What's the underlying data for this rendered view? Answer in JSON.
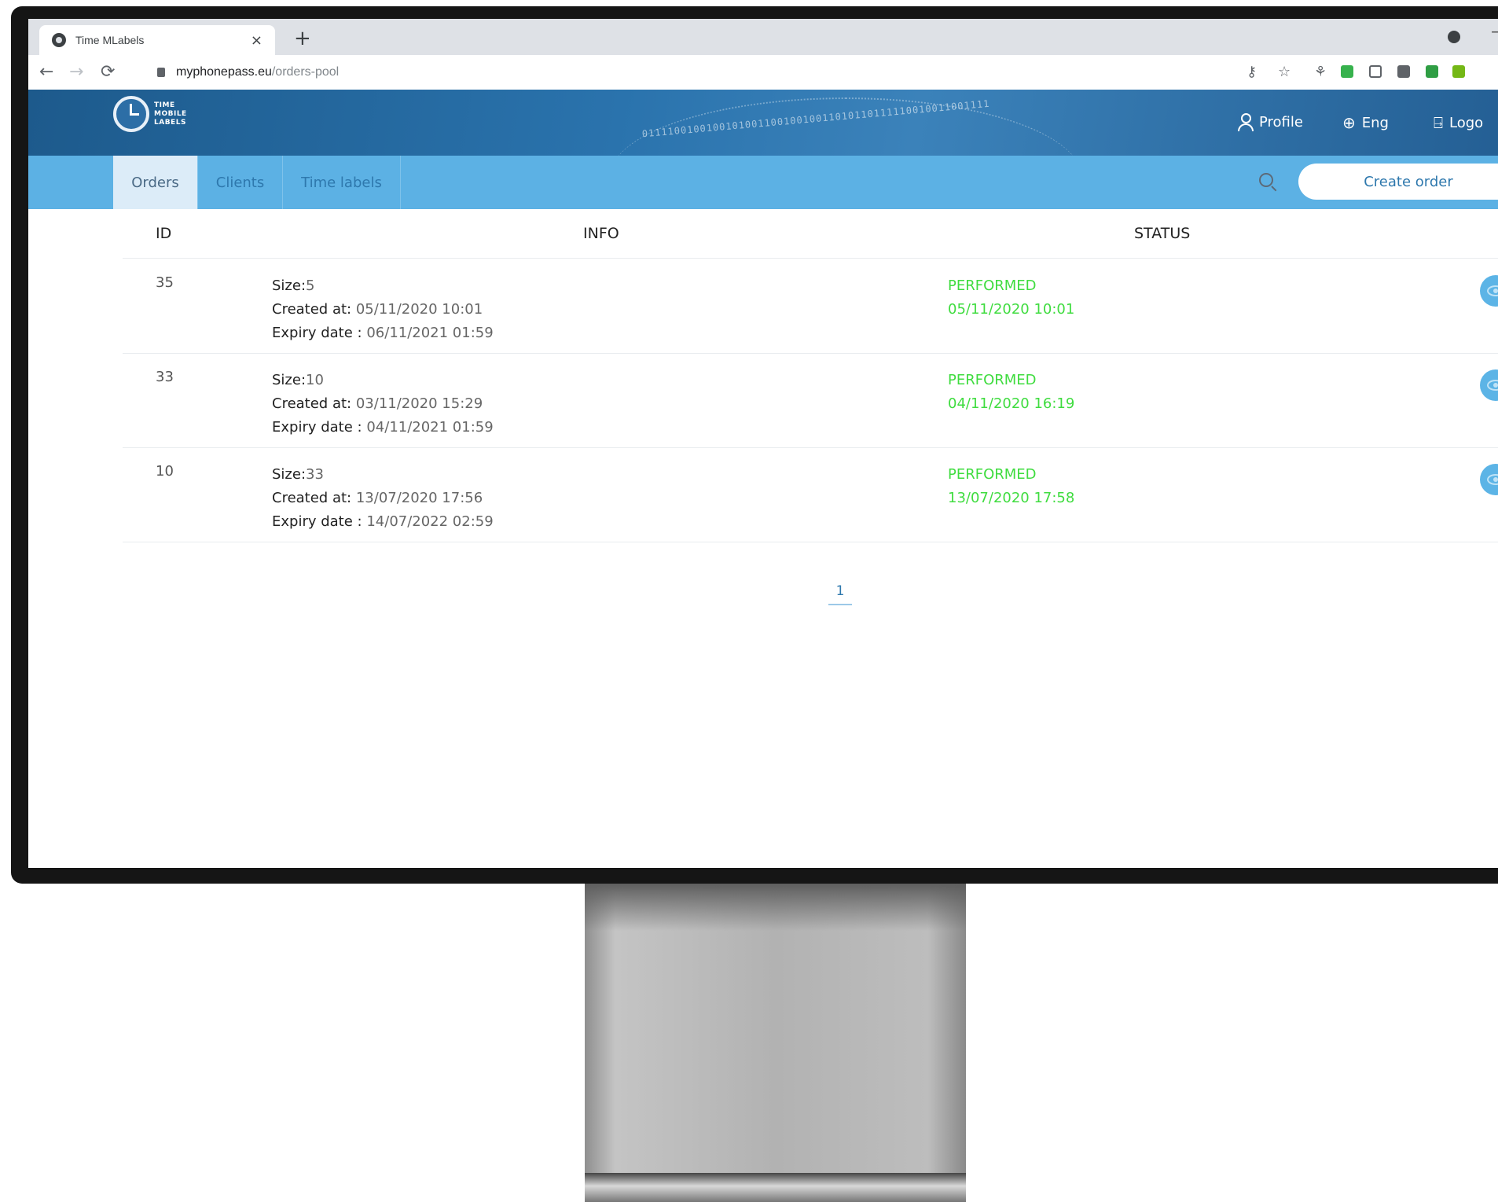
{
  "browser": {
    "tab_title": "Time MLabels",
    "tab_close": "×",
    "new_tab": "+",
    "url_host": "myphonepass.eu",
    "url_path": "/orders-pool"
  },
  "header": {
    "logo_lines": [
      "TIME",
      "MOBILE",
      "LABELS"
    ],
    "binary_decor": "011110010010010100110010010011010110111110010011001111",
    "profile": "Profile",
    "language": "Eng",
    "logout": "Logo"
  },
  "subnav": {
    "tabs": [
      "Orders",
      "Clients",
      "Time labels"
    ],
    "active_tab": "Orders",
    "create_order": "Create order"
  },
  "table": {
    "columns": {
      "id": "ID",
      "info": "INFO",
      "status": "STATUS"
    },
    "labels": {
      "size": "Size:",
      "created": "Created at:",
      "expiry": "Expiry date :"
    },
    "rows": [
      {
        "id": "35",
        "size": "5",
        "created": "05/11/2020 10:01",
        "expiry": "06/11/2021 01:59",
        "status": "PERFORMED",
        "status_date": "05/11/2020 10:01"
      },
      {
        "id": "33",
        "size": "10",
        "created": "03/11/2020 15:29",
        "expiry": "04/11/2021 01:59",
        "status": "PERFORMED",
        "status_date": "04/11/2020 16:19"
      },
      {
        "id": "10",
        "size": "33",
        "created": "13/07/2020 17:56",
        "expiry": "14/07/2022 02:59",
        "status": "PERFORMED",
        "status_date": "13/07/2020 17:58"
      }
    ]
  },
  "pagination": {
    "current": "1"
  },
  "colors": {
    "header_blue": "#2a73ad",
    "subnav_blue": "#5cb1e4",
    "status_green": "#3fdc3f",
    "accent": "#2e78ad"
  },
  "icons": [
    "globe-icon",
    "user-icon",
    "logout-icon",
    "search-icon",
    "eye-icon",
    "lock-icon",
    "star-icon",
    "key-icon"
  ]
}
